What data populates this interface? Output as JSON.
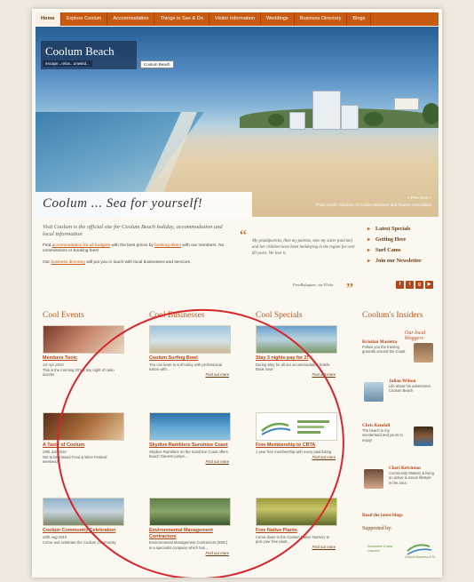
{
  "nav": {
    "items": [
      "Home",
      "Explore Coolum",
      "Accommodation",
      "Things to See & Do",
      "Visitor Information",
      "Weddings",
      "Business Directory",
      "Blogs"
    ]
  },
  "hero": {
    "title": "Coolum Beach",
    "subtitle": "escape...relax...unwind...",
    "tooltip": "Coolum Beach",
    "caption": "Coolum ... Sea for yourself!",
    "controls": "« Prev  Next »",
    "credit": "Photo Credit: Courtesy of Coolum Business and Tourism Association"
  },
  "intro": {
    "lead": "Visit Coolum is the official site for Coolum Beach holiday, accommodation and local information",
    "p1_a": "Find ",
    "p1_link1": "accommodation for all budgets",
    "p1_b": " with the best prices by ",
    "p1_link2": "booking direct",
    "p1_c": " with our members. No commissions or booking fees!",
    "p2_a": "Our ",
    "p2_link": "business directory",
    "p2_b": " will put you in touch with local businesses and services."
  },
  "quote": {
    "open": "“",
    "close": "”",
    "text": "My grandparents, then my parents, now my sister (and me) and her children have been holidaying in the region for over 60 years. We love it.",
    "author": "FreeRefugium, via Flickr"
  },
  "quick_links": [
    "Latest Specials",
    "Getting Here",
    "Surf Cams",
    "Join our Newsletter"
  ],
  "social": [
    "f",
    "t",
    "g",
    "▶"
  ],
  "sections": {
    "events": "Cool Events",
    "businesses": "Cool Businesses",
    "specials": "Cool Specials",
    "insiders": "Coolum's Insiders",
    "insiders_sub": "Our local bloggers"
  },
  "events": [
    {
      "title": "Members Tonic",
      "date": "1st Apr 2010",
      "desc": "This is the morning 20's a tiny night of radio dazzle!"
    },
    {
      "title": "A Taste of Coolum",
      "date": "29th Jun 2010",
      "desc": "Not to be missed Food & Wine Festival weekend"
    },
    {
      "title": "Coolum Community Celebration",
      "date": "20th Aug 2010",
      "desc": "Come and celebrate the Coolum Community"
    }
  ],
  "businesses": [
    {
      "title": "Coolum Surfing Bowl",
      "desc": "You can learn to surf today with professional tuition with...",
      "more": "Find out more"
    },
    {
      "title": "Skydive Ramblers Sunshine Coast",
      "desc": "Skydive Ramblers on the Sunshine Coast offers beach Tandem jumps...",
      "more": "Find out more"
    },
    {
      "title": "Environmental Management Contractors",
      "desc": "Environmental Management Contractors (EMC) is a specialist company which has...",
      "more": "Find out more"
    }
  ],
  "specials": [
    {
      "title": "Stay 3 nights pay for 2!",
      "desc": "During May for all our accommodation hotels. Book now!",
      "more": "Find out more"
    },
    {
      "title": "Free Membership to CBTA",
      "desc": "1 year free membership with every paid listing",
      "more": "Find out more"
    },
    {
      "title": "Free Native Plants",
      "desc": "Come down to the Coolum Native Nursery to pick your free plant...",
      "more": "Find out more"
    }
  ],
  "insiders": [
    {
      "name": "Kristian Masietta",
      "desc": "Follow you the training grounds around the Coast"
    },
    {
      "name": "Julian Wilson",
      "desc": "Life about his adventures, Coolum Beach"
    },
    {
      "name": "Chris Kendall",
      "desc": "The beach is my wonderland and yours to enjoy!"
    },
    {
      "name": "Cheri Kelvinton",
      "desc": "Community Matters & living an active & social lifestyle in the area"
    }
  ],
  "latest_blogs": "Read the latest blogs",
  "supported_by": "Supported by:",
  "sponsors": [
    "Sunshine Coast Council",
    "Coolum Business & Tourism"
  ],
  "colors": {
    "accent": "#c75b12",
    "link": "#b3461a",
    "annotation": "#d8262b"
  }
}
